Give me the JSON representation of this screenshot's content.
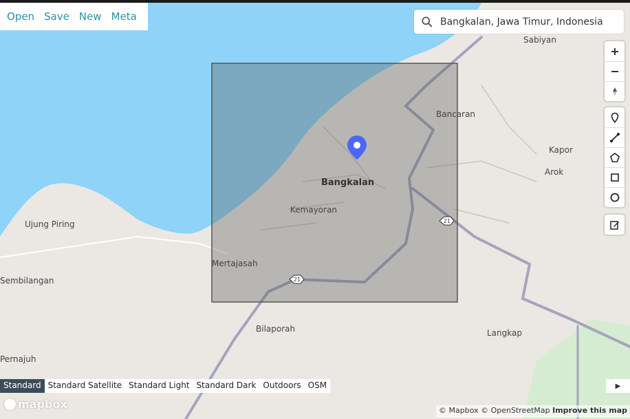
{
  "menu": {
    "items": [
      "Open",
      "Save",
      "New",
      "Meta"
    ]
  },
  "search": {
    "value": "Bangkalan, Jawa Timur, Indonesia"
  },
  "map": {
    "labels": [
      "Sabiyan",
      "Bancaran",
      "Kapor",
      "Arok",
      "Bangkalan",
      "Kemayoran",
      "Ujung Piring",
      "Mertajasah",
      "Sembilangan",
      "Bilaporah",
      "Langkap",
      "Pernajuh"
    ],
    "road_shields": [
      "21",
      "21"
    ],
    "colors": {
      "water": "#8fd3f8",
      "land": "#ebe8e4",
      "road": "#a4a4bd",
      "selection": "rgba(90,90,90,0.35)",
      "marker": "#4c67f5"
    }
  },
  "controls": {
    "nav": [
      "zoom-in",
      "zoom-out",
      "compass"
    ],
    "draw": [
      "marker",
      "line",
      "polygon",
      "rectangle",
      "circle"
    ],
    "edit": [
      "edit"
    ]
  },
  "styles": {
    "options": [
      "Standard",
      "Standard Satellite",
      "Standard Light",
      "Standard Dark",
      "Outdoors",
      "OSM"
    ],
    "active": "Standard"
  },
  "logo": "mapbox",
  "attribution": {
    "mapbox": "© Mapbox",
    "osm": "© OpenStreetMap",
    "improve": "Improve this map"
  }
}
